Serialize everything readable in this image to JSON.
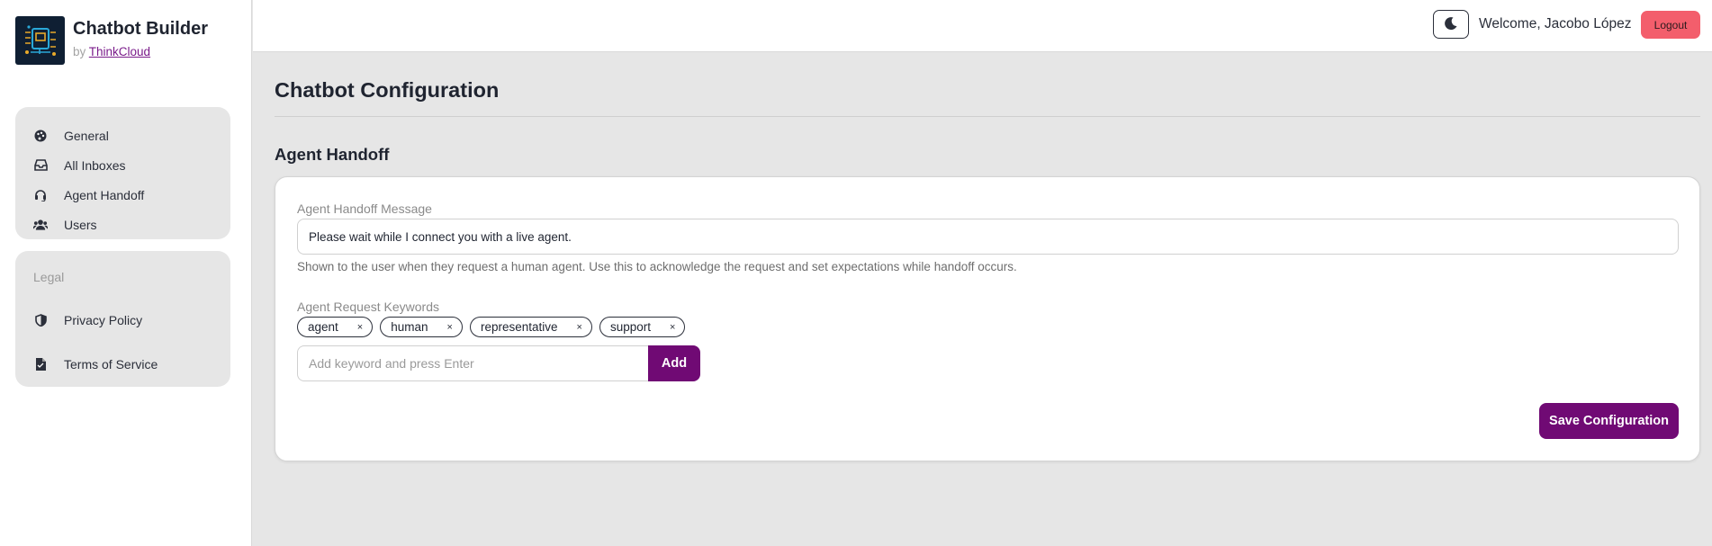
{
  "app": {
    "title": "Chatbot Builder",
    "by_prefix": "by",
    "by_link": "ThinkCloud"
  },
  "sidebar": {
    "items": [
      {
        "label": "General",
        "icon": "palette-icon"
      },
      {
        "label": "All Inboxes",
        "icon": "inbox-icon"
      },
      {
        "label": "Agent Handoff",
        "icon": "headset-icon"
      },
      {
        "label": "Users",
        "icon": "users-icon"
      }
    ],
    "legal": {
      "title": "Legal",
      "items": [
        {
          "label": "Privacy Policy",
          "icon": "shield-icon"
        },
        {
          "label": "Terms of Service",
          "icon": "document-icon"
        }
      ]
    }
  },
  "header": {
    "theme_icon": "moon-icon",
    "welcome": "Welcome, Jacobo López",
    "logout_label": "Logout"
  },
  "main": {
    "page_title": "Chatbot Configuration",
    "section_title": "Agent Handoff",
    "handoff_message": {
      "label": "Agent Handoff Message",
      "value": "Please wait while I connect you with a live agent.",
      "help": "Shown to the user when they request a human agent. Use this to acknowledge the request and set expectations while handoff occurs."
    },
    "keywords": {
      "label": "Agent Request Keywords",
      "chips": [
        "agent",
        "human",
        "representative",
        "support"
      ],
      "remove_glyph": "×",
      "input_placeholder": "Add keyword and press Enter",
      "add_label": "Add"
    },
    "save_label": "Save Configuration"
  },
  "colors": {
    "primary": "#700a74",
    "danger": "#f35e6c",
    "link": "#7a1b8a",
    "panel": "#e6e6e6"
  }
}
